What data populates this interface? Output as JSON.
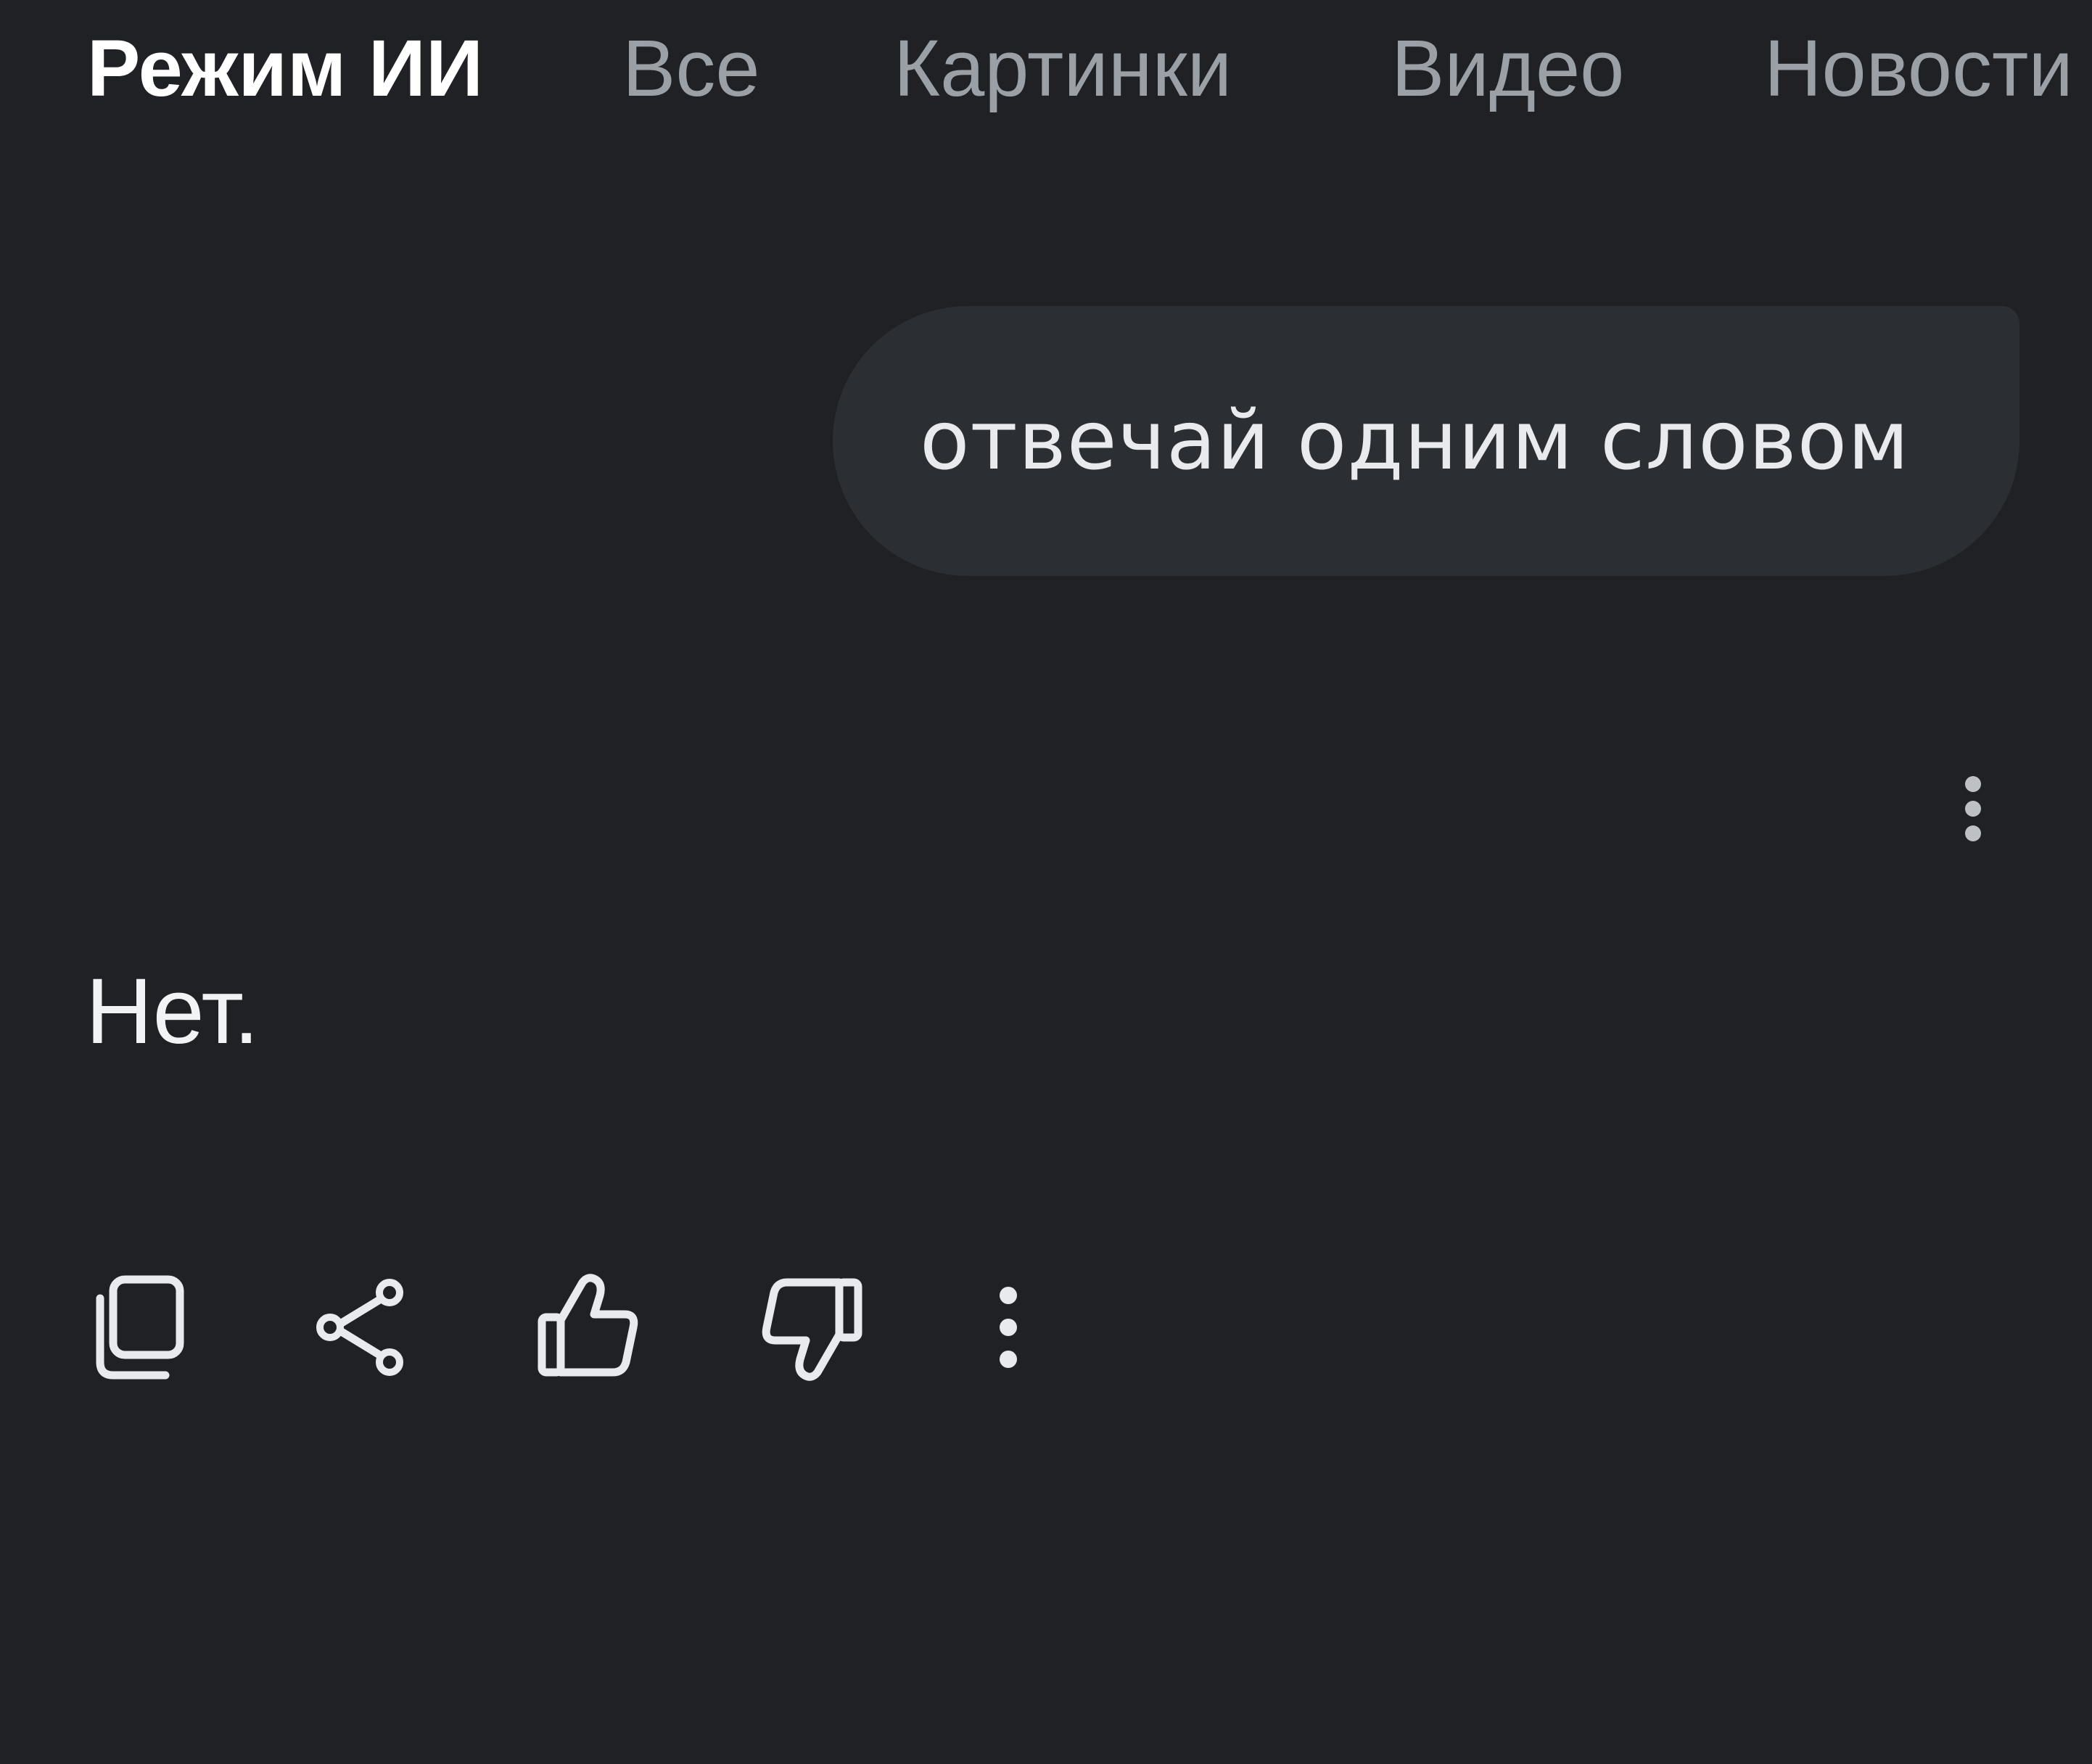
{
  "tabs": [
    {
      "label": "Режим ИИ",
      "active": true
    },
    {
      "label": "Все",
      "active": false
    },
    {
      "label": "Картинки",
      "active": false
    },
    {
      "label": "Видео",
      "active": false
    },
    {
      "label": "Новости",
      "active": false
    }
  ],
  "conversation": {
    "user_query": "отвечай одним словом",
    "answer": "Нет."
  },
  "icons": {
    "answer_menu": "more-vertical-icon",
    "copy": "copy-icon",
    "share": "share-icon",
    "like": "thumbs-up-icon",
    "dislike": "thumbs-down-icon",
    "more": "more-vertical-icon"
  },
  "colors": {
    "background": "#202124",
    "bubble": "#2b2e33",
    "active_tab": "#ffffff",
    "inactive_tab": "#9aa0a6",
    "text": "#e8eaed",
    "icon": "#e8eaed"
  }
}
